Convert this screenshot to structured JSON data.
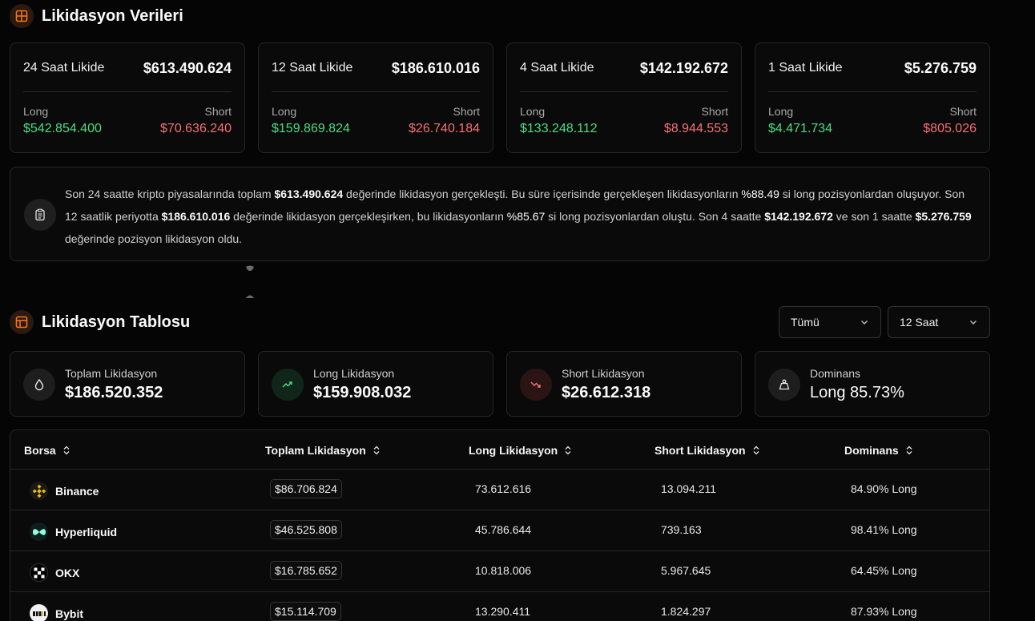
{
  "liquidation_data": {
    "title": "Likidasyon Verileri",
    "cards": [
      {
        "label": "24 Saat Likide",
        "total": "$613.490.624",
        "long_label": "Long",
        "short_label": "Short",
        "long": "$542.854.400",
        "short": "$70.636.240"
      },
      {
        "label": "12 Saat Likide",
        "total": "$186.610.016",
        "long_label": "Long",
        "short_label": "Short",
        "long": "$159.869.824",
        "short": "$26.740.184"
      },
      {
        "label": "4 Saat Likide",
        "total": "$142.192.672",
        "long_label": "Long",
        "short_label": "Short",
        "long": "$133.248.112",
        "short": "$8.944.553"
      },
      {
        "label": "1 Saat Likide",
        "total": "$5.276.759",
        "long_label": "Long",
        "short_label": "Short",
        "long": "$4.471.734",
        "short": "$805.026"
      }
    ],
    "summary": {
      "p1": "Son 24 saatte kripto piyasalarında toplam ",
      "v1": "$613.490.624",
      "p2": " değerinde likidasyon gerçekleşti. Bu süre içerisinde gerçekleşen likidasyonların ",
      "v2": "%88.49",
      "p3": " si long pozisyonlardan oluşuyor. Son 12 saatlik periyotta ",
      "v3": "$186.610.016",
      "p4": " değerinde likidasyon gerçekleşirken, bu likidasyonların ",
      "v4": "%85.67",
      "p5": " si long pozisyonlardan oluştu. Son 4 saatte ",
      "v5": "$142.192.672",
      "p6": " ve son 1 saatte ",
      "v6": "$5.276.759",
      "p7": " değerinde pozisyon likidasyon oldu."
    }
  },
  "liquidation_table": {
    "title": "Likidasyon Tablosu",
    "filter_select": {
      "value": "Tümü"
    },
    "period_select": {
      "value": "12 Saat"
    },
    "stats": [
      {
        "label": "Toplam Likidasyon",
        "value": "$186.520.352",
        "icon": "drop-icon"
      },
      {
        "label": "Long Likidasyon",
        "value": "$159.908.032",
        "icon": "trending-up-icon"
      },
      {
        "label": "Short Likidasyon",
        "value": "$26.612.318",
        "icon": "trending-down-icon"
      },
      {
        "label": "Dominans",
        "value": "Long 85.73%",
        "icon": "weight-icon"
      }
    ],
    "columns": [
      "Borsa",
      "Toplam Likidasyon",
      "Long Likidasyon",
      "Short Likidasyon",
      "Dominans"
    ],
    "rows": [
      {
        "exchange": "Binance",
        "total": "$86.706.824",
        "long": "73.612.616",
        "short": "13.094.211",
        "dominance": "84.90% Long"
      },
      {
        "exchange": "Hyperliquid",
        "total": "$46.525.808",
        "long": "45.786.644",
        "short": "739.163",
        "dominance": "98.41% Long"
      },
      {
        "exchange": "OKX",
        "total": "$16.785.652",
        "long": "10.818.006",
        "short": "5.967.645",
        "dominance": "64.45% Long"
      },
      {
        "exchange": "Bybit",
        "total": "$15.114.709",
        "long": "13.290.411",
        "short": "1.824.297",
        "dominance": "87.93% Long"
      }
    ]
  },
  "colors": {
    "background": "#050505",
    "accent": "#f97316",
    "long": "#4ade80",
    "short": "#f87171"
  }
}
